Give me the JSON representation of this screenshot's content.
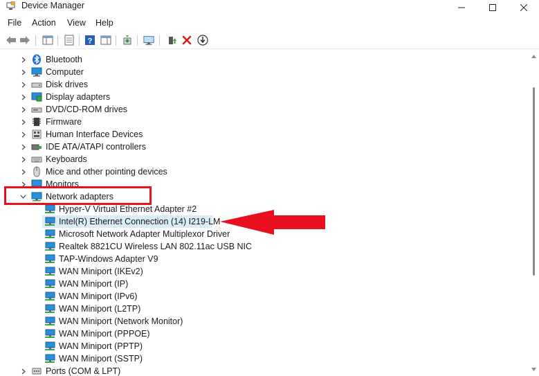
{
  "window": {
    "title": "Device Manager"
  },
  "menu": [
    "File",
    "Action",
    "View",
    "Help"
  ],
  "tree": {
    "categories_top": [
      {
        "label": "Bluetooth",
        "icon": "bluetooth-icon"
      },
      {
        "label": "Computer",
        "icon": "computer-icon"
      },
      {
        "label": "Disk drives",
        "icon": "disk-drive-icon"
      },
      {
        "label": "Display adapters",
        "icon": "display-adapter-icon"
      },
      {
        "label": "DVD/CD-ROM drives",
        "icon": "dvd-drive-icon"
      },
      {
        "label": "Firmware",
        "icon": "firmware-icon"
      },
      {
        "label": "Human Interface Devices",
        "icon": "hid-icon"
      },
      {
        "label": "IDE ATA/ATAPI controllers",
        "icon": "ide-controller-icon"
      },
      {
        "label": "Keyboards",
        "icon": "keyboard-icon"
      },
      {
        "label": "Mice and other pointing devices",
        "icon": "mouse-icon"
      },
      {
        "label": "Monitors",
        "icon": "monitor-icon"
      }
    ],
    "expanded": {
      "label": "Network adapters",
      "icon": "network-adapter-icon"
    },
    "children": [
      "Hyper-V Virtual Ethernet Adapter #2",
      "Intel(R) Ethernet Connection (14) I219-LM",
      "Microsoft Network Adapter Multiplexor Driver",
      "Realtek 8821CU Wireless LAN 802.11ac USB NIC",
      "TAP-Windows Adapter V9",
      "WAN Miniport (IKEv2)",
      "WAN Miniport (IP)",
      "WAN Miniport (IPv6)",
      "WAN Miniport (L2TP)",
      "WAN Miniport (Network Monitor)",
      "WAN Miniport (PPPOE)",
      "WAN Miniport (PPTP)",
      "WAN Miniport (SSTP)"
    ],
    "selected_child": 1,
    "categories_bottom": [
      {
        "label": "Ports (COM & LPT)",
        "icon": "port-icon"
      }
    ]
  },
  "colors": {
    "highlight": "#e8101e",
    "selection": "#d9ecfa",
    "network_icon": "#2a8fd8"
  }
}
